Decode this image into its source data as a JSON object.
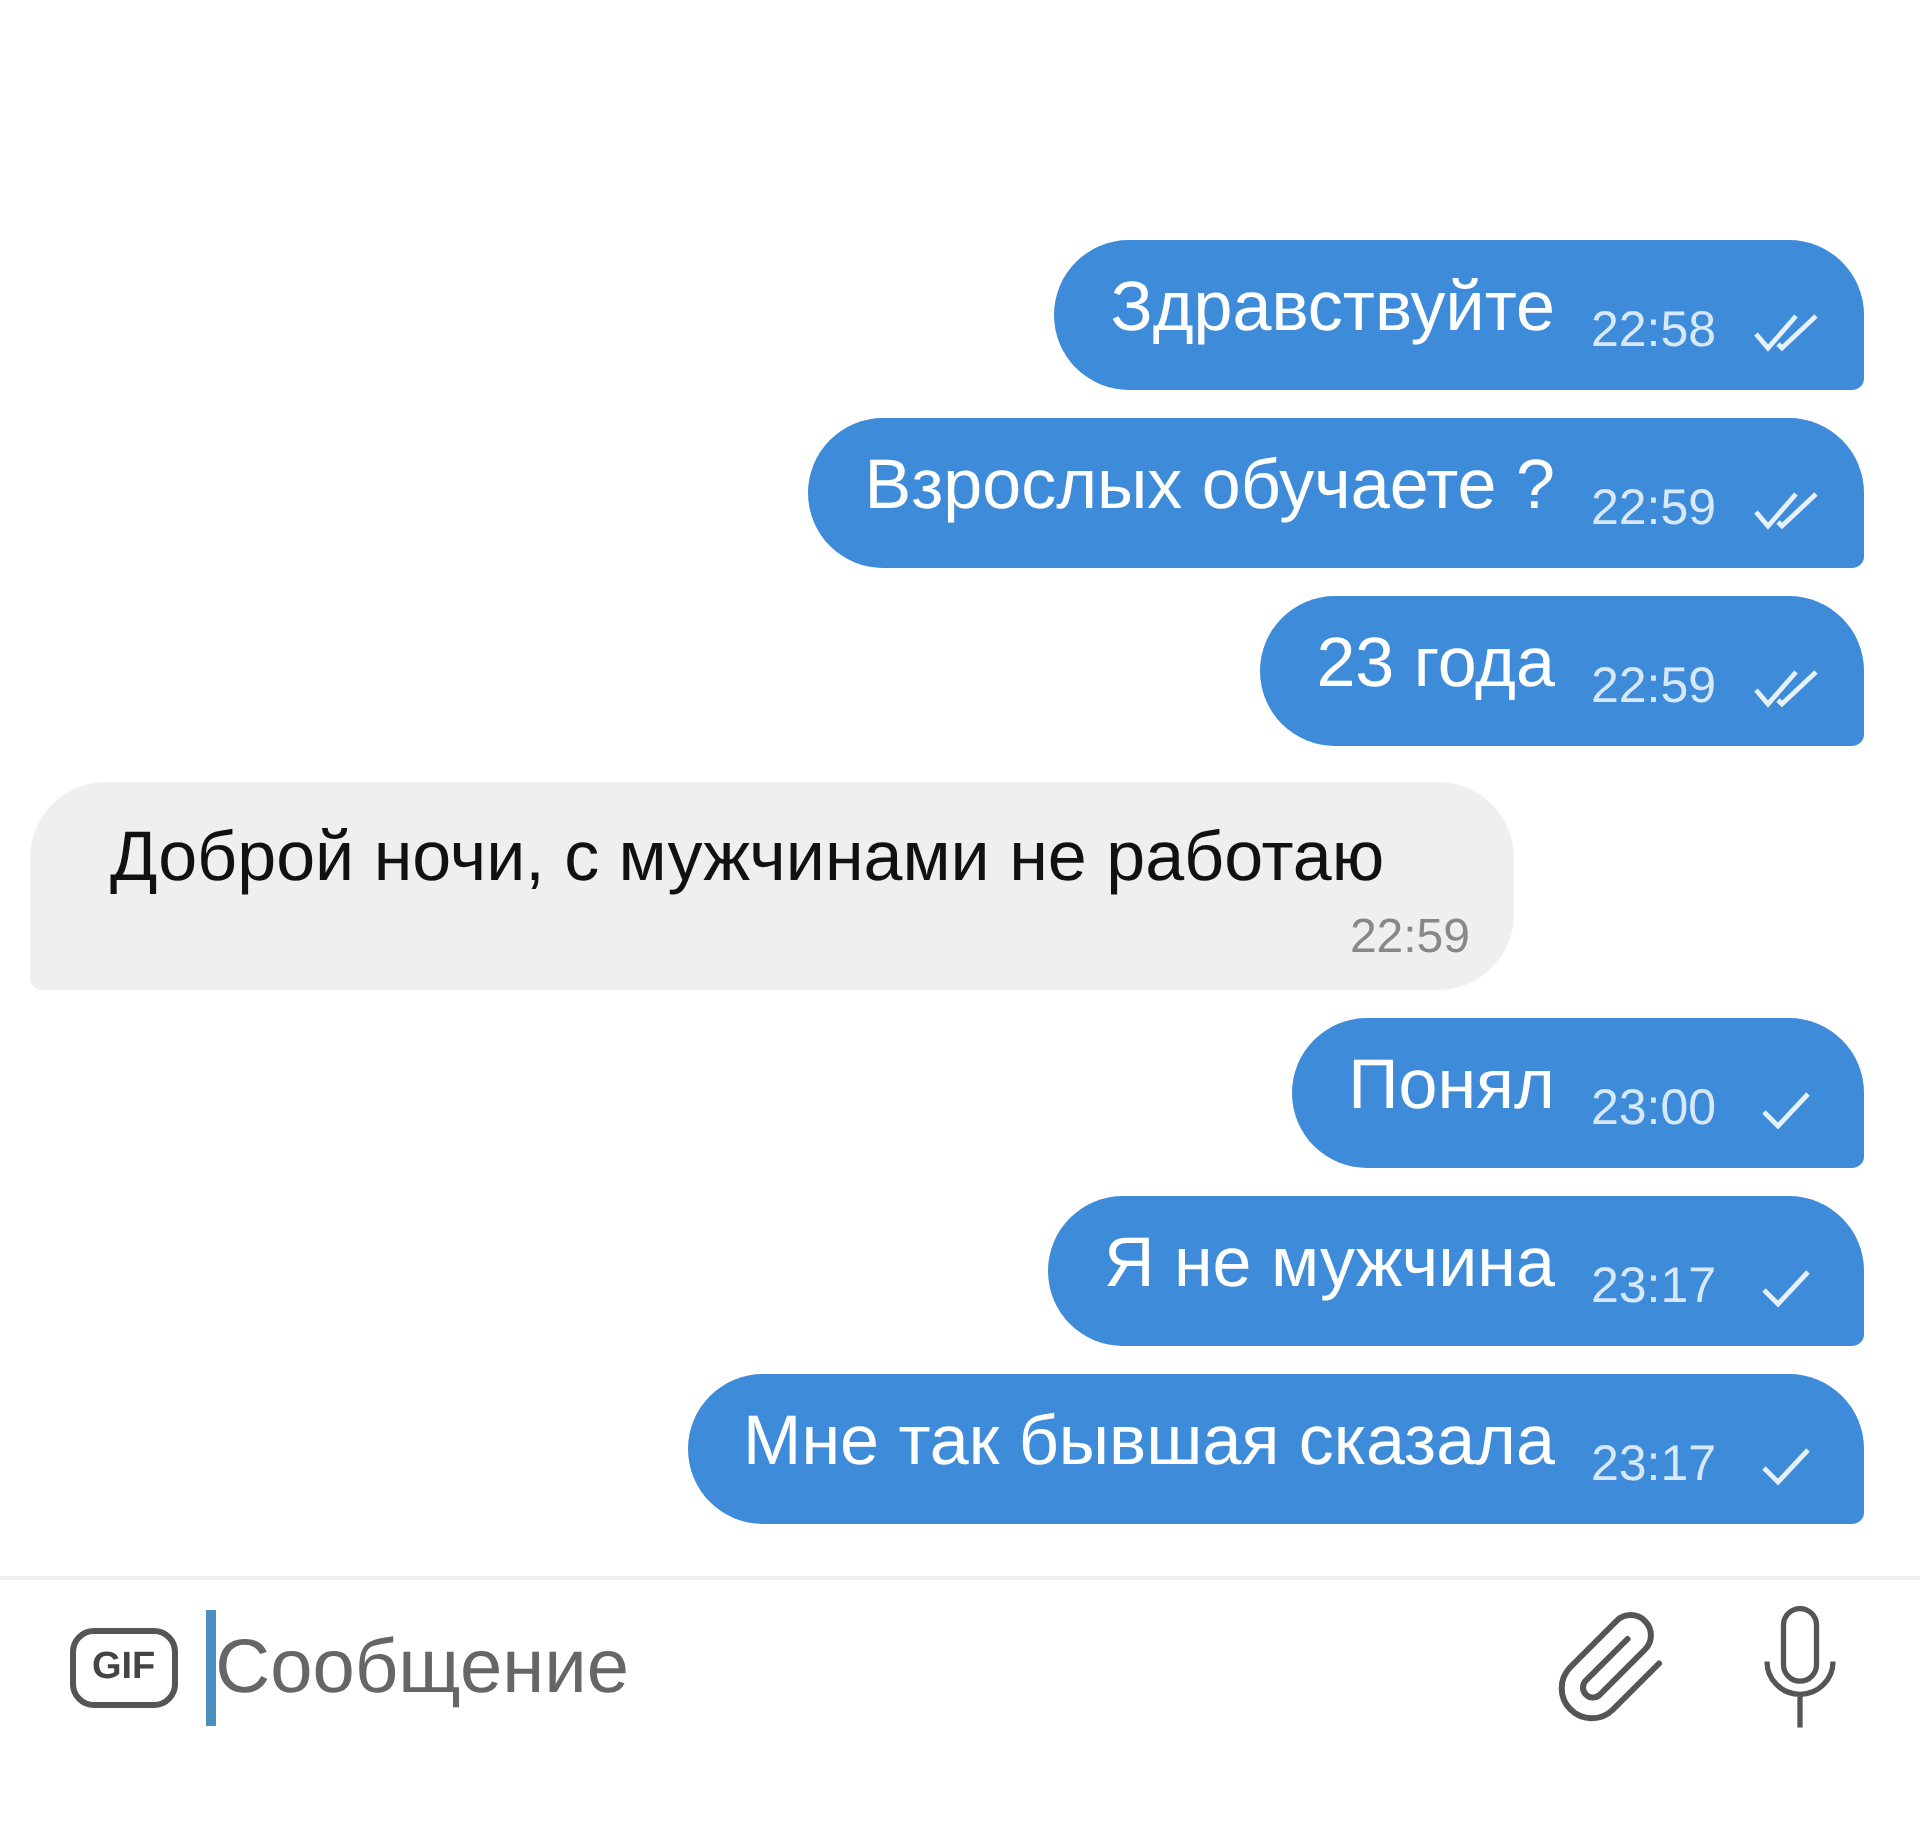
{
  "messages": [
    {
      "kind": "outgoing",
      "text": "Здравствуйте",
      "time": "22:58",
      "read": true
    },
    {
      "kind": "outgoing",
      "text": "Взрослых обучаете ?",
      "time": "22:59",
      "read": true
    },
    {
      "kind": "outgoing",
      "text": "23 года",
      "time": "22:59",
      "read": true
    },
    {
      "kind": "incoming",
      "text": "Доброй ночи, с мужчинами не работаю",
      "time": "22:59"
    },
    {
      "kind": "outgoing",
      "text": "Понял",
      "time": "23:00",
      "read": false
    },
    {
      "kind": "outgoing",
      "text": "Я не мужчина",
      "time": "23:17",
      "read": false
    },
    {
      "kind": "outgoing",
      "text": "Мне так бывшая сказала",
      "time": "23:17",
      "read": false
    }
  ],
  "composer": {
    "gif_label": "GIF",
    "placeholder": "Сообщение",
    "focused": true
  }
}
